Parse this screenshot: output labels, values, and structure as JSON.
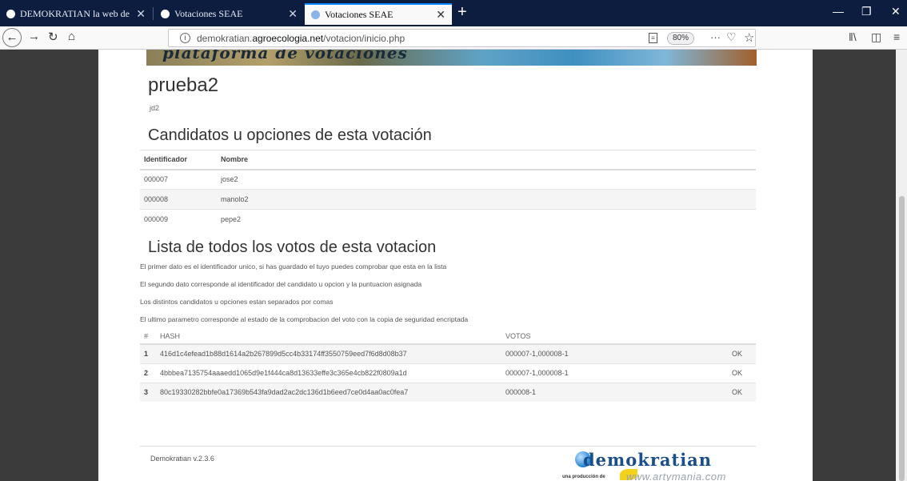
{
  "browser": {
    "tabs": [
      {
        "title": "DEMOKRATIAN la web de votac"
      },
      {
        "title": "Votaciones SEAE"
      },
      {
        "title": "Votaciones SEAE"
      }
    ],
    "url_prefix": "demokratian.",
    "url_domain": "agroecologia.net",
    "url_path": "/votacion/inicio.php",
    "zoom": "80%"
  },
  "page": {
    "title": "prueba2",
    "subtitle": "jd2",
    "candidates_heading": "Candidatos u opciones de esta votación",
    "candidates_headers": {
      "id": "Identificador",
      "name": "Nombre"
    },
    "candidates": [
      {
        "id": "000007",
        "name": "jose2"
      },
      {
        "id": "000008",
        "name": "manolo2"
      },
      {
        "id": "000009",
        "name": "pepe2"
      }
    ],
    "votes_heading": "Lista de todos los votos de esta votacion",
    "notes": [
      "El primer dato es el identificador unico, si has guardado el tuyo puedes comprobar que esta en la lista",
      "El segundo dato corresponde al identificador del candidato u opcion y la puntuacion asignada",
      "Los distintos candidatos u opciones estan separados por comas",
      "El ultimo parametro corresponde al estado de la comprobacion del voto con la copia de seguridad encriptada"
    ],
    "votes_headers": {
      "num": "#",
      "hash": "HASH",
      "votes": "VOTOS"
    },
    "votes": [
      {
        "num": "1",
        "hash": "416d1c4efead1b88d1614a2b267899d5cc4b33174ff3550759eed7f6d8d08b37",
        "votes": "000007-1,000008-1",
        "status": "OK"
      },
      {
        "num": "2",
        "hash": "4bbbea7135754aaaedd1065d9e1f444ca8d13633effe3c365e4cb822f0809a1d",
        "votes": "000007-1,000008-1",
        "status": "OK"
      },
      {
        "num": "3",
        "hash": "80c19330282bbfe0a17369b543fa9dad2ac2dc136d1b6eed7ce0d4aa0ac0fea7",
        "votes": "000008-1",
        "status": "OK"
      }
    ],
    "version": "Demokratian v.2.3.6",
    "logo": "demokratian",
    "logo_tagline": "una producción de",
    "logo_url": "www.artymania.com"
  }
}
